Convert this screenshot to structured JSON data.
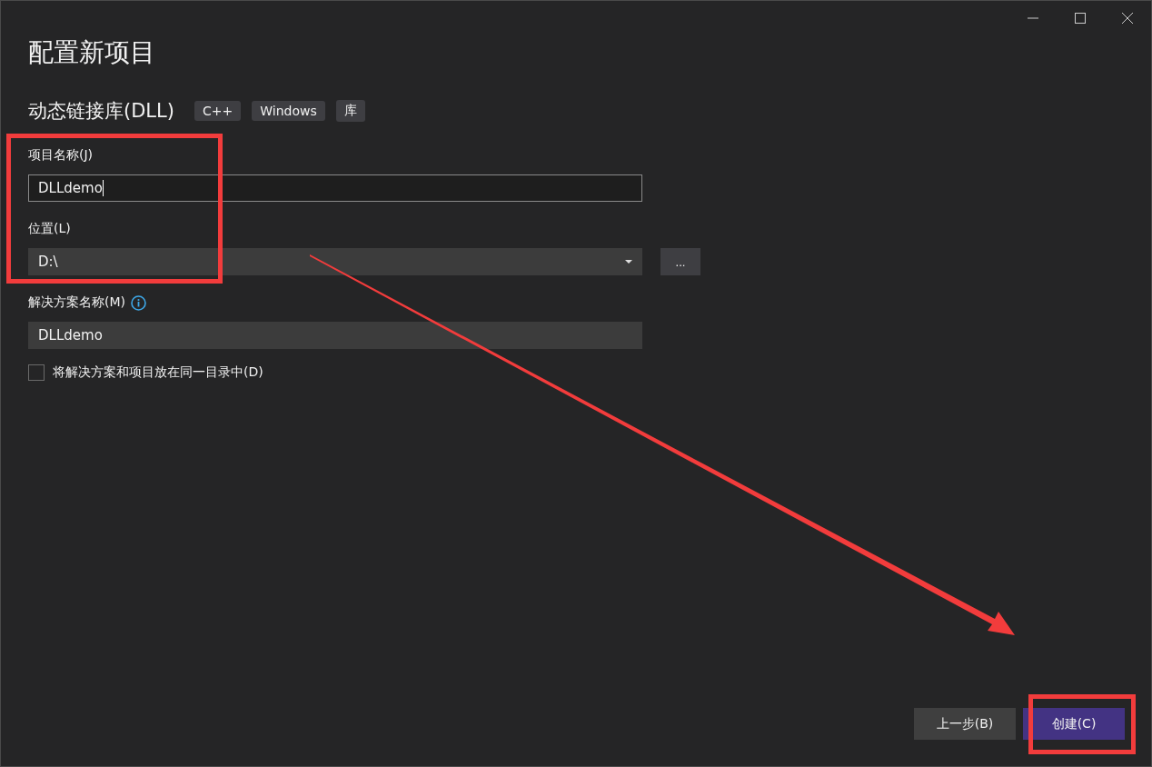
{
  "window": {
    "title": "配置新项目"
  },
  "template": {
    "name": "动态链接库(DLL)",
    "tags": [
      "C++",
      "Windows",
      "库"
    ]
  },
  "fields": [
    {
      "kind": "text",
      "label": "项目名称(J)",
      "value": "DLLdemo",
      "focused": true,
      "info": false
    },
    {
      "kind": "dropdown",
      "label": "位置(L)",
      "value": "D:\\",
      "browse": "...",
      "info": false
    },
    {
      "kind": "text",
      "label": "解决方案名称(M)",
      "value": "DLLdemo",
      "focused": false,
      "info": true
    }
  ],
  "same_directory": {
    "label": "将解决方案和项目放在同一目录中(D)",
    "checked": false
  },
  "buttons": [
    {
      "label": "上一步(B)",
      "primary": false
    },
    {
      "label": "创建(C)",
      "primary": true
    }
  ],
  "annotations": [
    {
      "kind": "rect"
    },
    {
      "kind": "arrow"
    },
    {
      "kind": "rect"
    }
  ]
}
